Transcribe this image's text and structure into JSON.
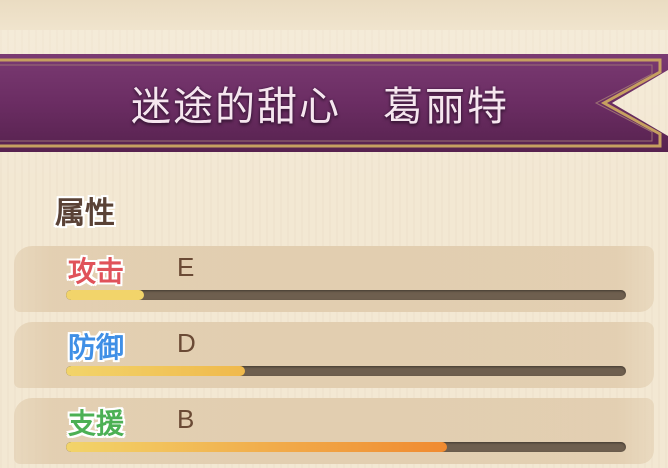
{
  "banner": {
    "title": "迷途的甜心　葛丽特"
  },
  "section": {
    "title": "属性"
  },
  "stats": [
    {
      "label": "攻击",
      "grade": "E",
      "progress": 0.14,
      "label_color": "#e0525a",
      "bar_color_start": "#f2d46a",
      "bar_color_end": "#f2d46a"
    },
    {
      "label": "防御",
      "grade": "D",
      "progress": 0.32,
      "label_color": "#3f8fe6",
      "bar_color_start": "#f2d46a",
      "bar_color_end": "#f0b94c"
    },
    {
      "label": "支援",
      "grade": "B",
      "progress": 0.68,
      "label_color": "#4cb054",
      "bar_color_start": "#f2d46a",
      "bar_color_end": "#f08a30"
    }
  ],
  "colors": {
    "banner": "#6b2d63",
    "banner_border": "#c6a060",
    "text_brown": "#6a4a35"
  }
}
